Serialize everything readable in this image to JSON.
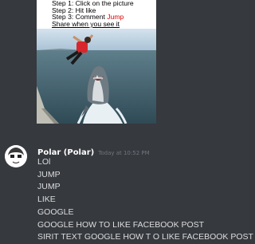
{
  "attachment": {
    "caption": {
      "step1": "Step 1: Click on the picture",
      "step2": "Step 2: Hit like",
      "step3_prefix": "Step 3: Comment ",
      "step3_word": "Jump",
      "step4": "Share when you see it"
    }
  },
  "message": {
    "username": "Polar (Polar)",
    "timestamp": "Today at 10:52 PM",
    "lines": [
      "LOl",
      "JUMP",
      "JUMP",
      "LIKE",
      "GOOGLE",
      "GOOGLE HOW TO LIKE FACEBOOK POST",
      "SIRIT TEXT GOOGLE HOW T O LIKE FACEBOOK POST"
    ]
  },
  "colors": {
    "background": "#36393e",
    "username": "#ffffff",
    "timestamp": "#72767d",
    "message_text": "#dcddde",
    "caption_accent": "#e00000"
  }
}
